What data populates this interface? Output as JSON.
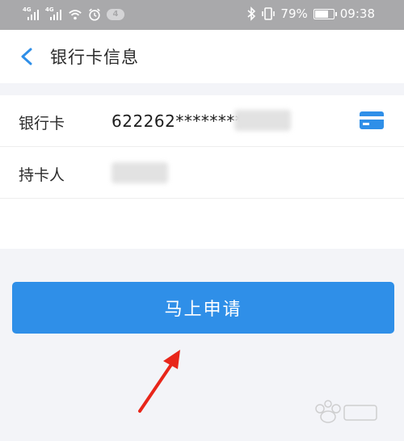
{
  "status_bar": {
    "signal_1_tag": "4G",
    "signal_2_tag": "4G",
    "notification_count": "4",
    "battery_percent": "79%",
    "battery_level": 0.79,
    "time": "09:38"
  },
  "header": {
    "title": "银行卡信息"
  },
  "bank_info": {
    "card_label": "银行卡",
    "card_number": "622262********",
    "holder_label": "持卡人"
  },
  "apply_button": {
    "label": "马上申请"
  },
  "colors": {
    "accent": "#2f8fe8",
    "arrow": "#e8261a"
  },
  "icons": {
    "back": "chevron-left-icon",
    "card": "credit-card-icon"
  }
}
